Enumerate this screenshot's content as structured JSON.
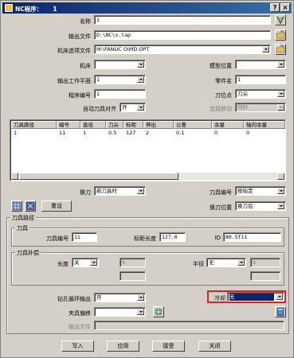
{
  "window": {
    "title": "NC程序：     1"
  },
  "title_buttons": [
    "?",
    "×"
  ],
  "form": {
    "name_label": "名称",
    "name_value": "1",
    "output_label": "输出文件",
    "output_value": "D:\\NC\\x.tap",
    "machine_opt_label": "机床选项文件",
    "machine_opt_value": "M:\\FANUC OiMD.OPT",
    "machine_label": "机床",
    "machine_value": "",
    "model_pos_label": "模型位置",
    "model_pos_value": "",
    "workplane_label": "输出工作平面",
    "workplane_value": "1",
    "part_no_label": "零件名",
    "part_no_value": "1",
    "prog_no_label": "程序编号",
    "prog_no_value": "1",
    "tool_point_label": "刀位点",
    "tool_point_value": "刀尖",
    "auto_align_label": "自动刀具对齐",
    "auto_align_value": "开",
    "connect_move_label": "连接移动",
    "connect_move_value": "同时"
  },
  "table": {
    "columns": [
      "刀具路径",
      "编号",
      "直径",
      "刀尖",
      "标距",
      "伸出",
      "公差",
      "余量",
      "轴向余量"
    ],
    "rows": [
      [
        "1",
        "11",
        "1",
        "0.5",
        "127",
        "2",
        "0.1",
        "0",
        "0"
      ]
    ]
  },
  "tool_opts": {
    "tool_change_label": "换刀",
    "tool_change_value": "新刀具时",
    "tool_no_label": "刀具编号",
    "tool_no_value": "按指定",
    "tool_change_pos_label": "换刀位置",
    "tool_change_pos_value": "换刀后",
    "reset_label": "重设"
  },
  "toolpath_group": {
    "label": "刀具路径",
    "tool_group_label": "刀具",
    "tool_no_label": "刀具编号",
    "tool_no_value": "11",
    "gauge_label": "标距长度",
    "gauge_value": "127.0",
    "id_label": "ID",
    "id_value": "B0.5T11",
    "comp_group_label": "刀具补偿",
    "length_label": "长度",
    "length_value": "关",
    "length_num": "0",
    "radius_label": "半径",
    "radius_value": "无",
    "radius_num": "0",
    "drill_cycle_label": "钻孔循环输出",
    "drill_cycle_value": "开",
    "coolant_label": "冷却",
    "coolant_value": "无",
    "fixture_offset_label": "夹具偏移",
    "fixture_offset_value": "",
    "out_file_label": "输出文件",
    "out_file_value": ""
  },
  "buttons": {
    "write": "写入",
    "apply": "应用",
    "accept": "接受",
    "close": "关闭"
  },
  "colors": {
    "highlight_box": "#e02020",
    "title_bar": "#0a246a"
  }
}
